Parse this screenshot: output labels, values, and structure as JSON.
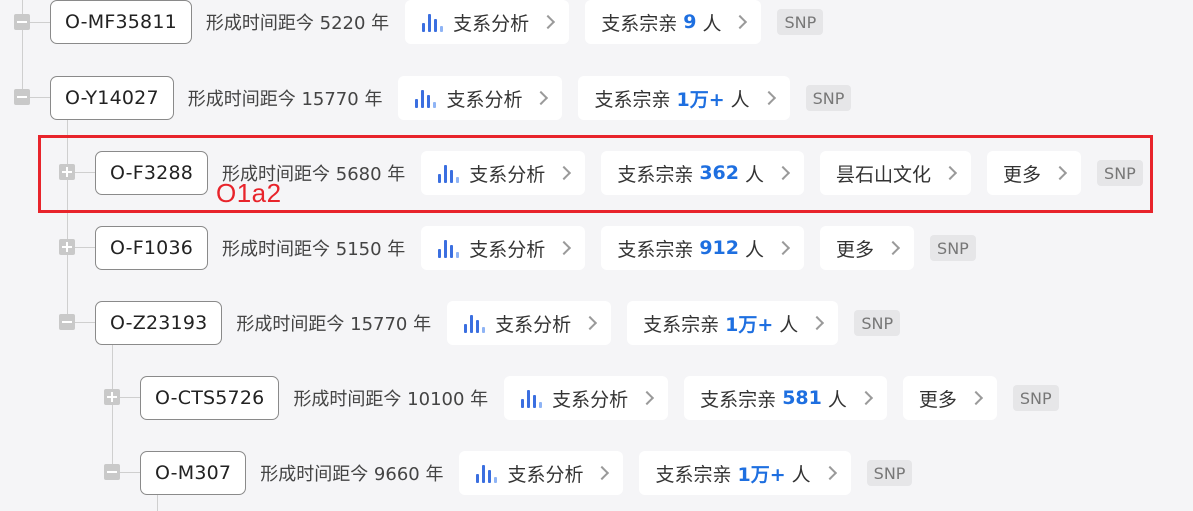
{
  "tree": {
    "rows": [
      {
        "id": "row-0",
        "node": "O-MF35811",
        "age_text": "形成时间距今 5220 年",
        "chips": [
          {
            "type": "analysis",
            "label": "支系分析"
          },
          {
            "type": "relatives",
            "prefix": "支系宗亲",
            "count": "9",
            "suffix": "人"
          }
        ],
        "snp": "SNP",
        "toggle": "minus"
      },
      {
        "id": "row-1",
        "node": "O-Y14027",
        "age_text": "形成时间距今 15770 年",
        "chips": [
          {
            "type": "analysis",
            "label": "支系分析"
          },
          {
            "type": "relatives",
            "prefix": "支系宗亲",
            "count": "1万+",
            "suffix": "人"
          }
        ],
        "snp": "SNP",
        "toggle": "minus"
      },
      {
        "id": "row-2",
        "node": "O-F3288",
        "age_text": "形成时间距今 5680 年",
        "chips": [
          {
            "type": "analysis",
            "label": "支系分析"
          },
          {
            "type": "relatives",
            "prefix": "支系宗亲",
            "count": "362",
            "suffix": "人"
          },
          {
            "type": "culture",
            "label": "昙石山文化"
          },
          {
            "type": "more",
            "label": "更多"
          }
        ],
        "snp": "SNP",
        "toggle": "plus"
      },
      {
        "id": "row-3",
        "node": "O-F1036",
        "age_text": "形成时间距今 5150 年",
        "chips": [
          {
            "type": "analysis",
            "label": "支系分析"
          },
          {
            "type": "relatives",
            "prefix": "支系宗亲",
            "count": "912",
            "suffix": "人"
          },
          {
            "type": "more",
            "label": "更多"
          }
        ],
        "snp": "SNP",
        "toggle": "plus"
      },
      {
        "id": "row-4",
        "node": "O-Z23193",
        "age_text": "形成时间距今 15770 年",
        "chips": [
          {
            "type": "analysis",
            "label": "支系分析"
          },
          {
            "type": "relatives",
            "prefix": "支系宗亲",
            "count": "1万+",
            "suffix": "人"
          }
        ],
        "snp": "SNP",
        "toggle": "minus"
      },
      {
        "id": "row-5",
        "node": "O-CTS5726",
        "age_text": "形成时间距今 10100 年",
        "chips": [
          {
            "type": "analysis",
            "label": "支系分析"
          },
          {
            "type": "relatives",
            "prefix": "支系宗亲",
            "count": "581",
            "suffix": "人"
          },
          {
            "type": "more",
            "label": "更多"
          }
        ],
        "snp": "SNP",
        "toggle": "plus"
      },
      {
        "id": "row-6",
        "node": "O-M307",
        "age_text": "形成时间距今 9660 年",
        "chips": [
          {
            "type": "analysis",
            "label": "支系分析"
          },
          {
            "type": "relatives",
            "prefix": "支系宗亲",
            "count": "1万+",
            "suffix": "人"
          }
        ],
        "snp": "SNP",
        "toggle": "minus"
      }
    ]
  },
  "annotation": {
    "label": "O1a2"
  },
  "colors": {
    "accent": "#1e6fe0",
    "highlight": "#e8242b",
    "background": "#f5f5f7",
    "connector": "#cfcfcf"
  },
  "icons": {
    "analysis": "bar-chart-icon",
    "chevron": "chevron-right-icon",
    "expand": "plus-icon",
    "collapse": "minus-icon"
  }
}
